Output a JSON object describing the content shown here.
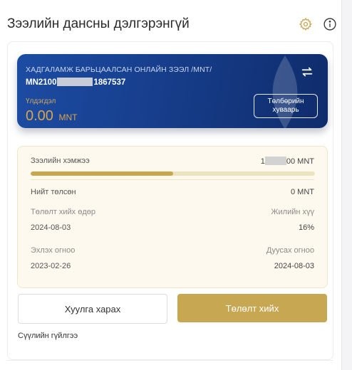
{
  "header": {
    "title": "Зээлийн дансны дэлгэрэнгүй",
    "settings_icon": "gear-icon",
    "info_icon": "info-icon"
  },
  "card": {
    "product_name": "ХАДГАЛАМЖ БАРЬЦААЛСАН ОНЛАЙН ЗЭЭЛ /MNT/",
    "account_prefix": "MN2100",
    "account_suffix": "1867537",
    "balance_label": "Үлдэгдэл",
    "balance_value": "0.00",
    "balance_currency": "MNT",
    "schedule_button": "Төлбөрийн хуваарь",
    "swap_icon": "swap-icon",
    "accent_color": "#d9a44b"
  },
  "details": {
    "loan_amount_label": "Зээлийн хэмжээ",
    "loan_amount_prefix": "1",
    "loan_amount_suffix": "00 MNT",
    "progress_fraction": 0.5,
    "total_paid_label": "Нийт төлсөн",
    "total_paid_value": "0 MNT",
    "payment_date_label": "Төлөлт хийх өдөр",
    "payment_date_value": "2024-08-03",
    "annual_rate_label": "Жилийн хүү",
    "annual_rate_value": "16%",
    "start_date_label": "Эхлэх огноо",
    "start_date_value": "2023-02-26",
    "end_date_label": "Дуусах огноо",
    "end_date_value": "2024-08-03"
  },
  "actions": {
    "view_contract": "Хуулга харах",
    "make_payment": "Төлөлт хийх",
    "primary_color": "#c8a753"
  },
  "recent": {
    "label": "Сүүлийн гүйлгээ"
  }
}
